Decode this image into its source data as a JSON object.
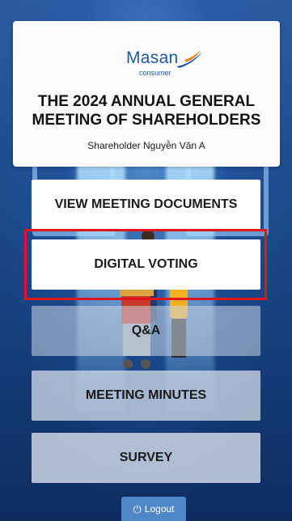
{
  "logo": {
    "brand": "Masan",
    "sub": "consumer"
  },
  "header": {
    "title": "THE 2024 ANNUAL GENERAL MEETING OF SHAREHOLDERS",
    "shareholder": "Shareholder Nguyễn Văn A"
  },
  "menu": {
    "documents_label": "VIEW MEETING DOCUMENTS",
    "voting_label": "DIGITAL VOTING",
    "qa_label": "Q&A",
    "minutes_label": "MEETING MINUTES",
    "survey_label": "SURVEY"
  },
  "footer": {
    "logout_label": "Logout",
    "logout_icon": "power-icon"
  },
  "colors": {
    "brand_blue": "#1d5aa6",
    "highlight": "#e3141c",
    "logout_bg": "#4f86c7"
  }
}
